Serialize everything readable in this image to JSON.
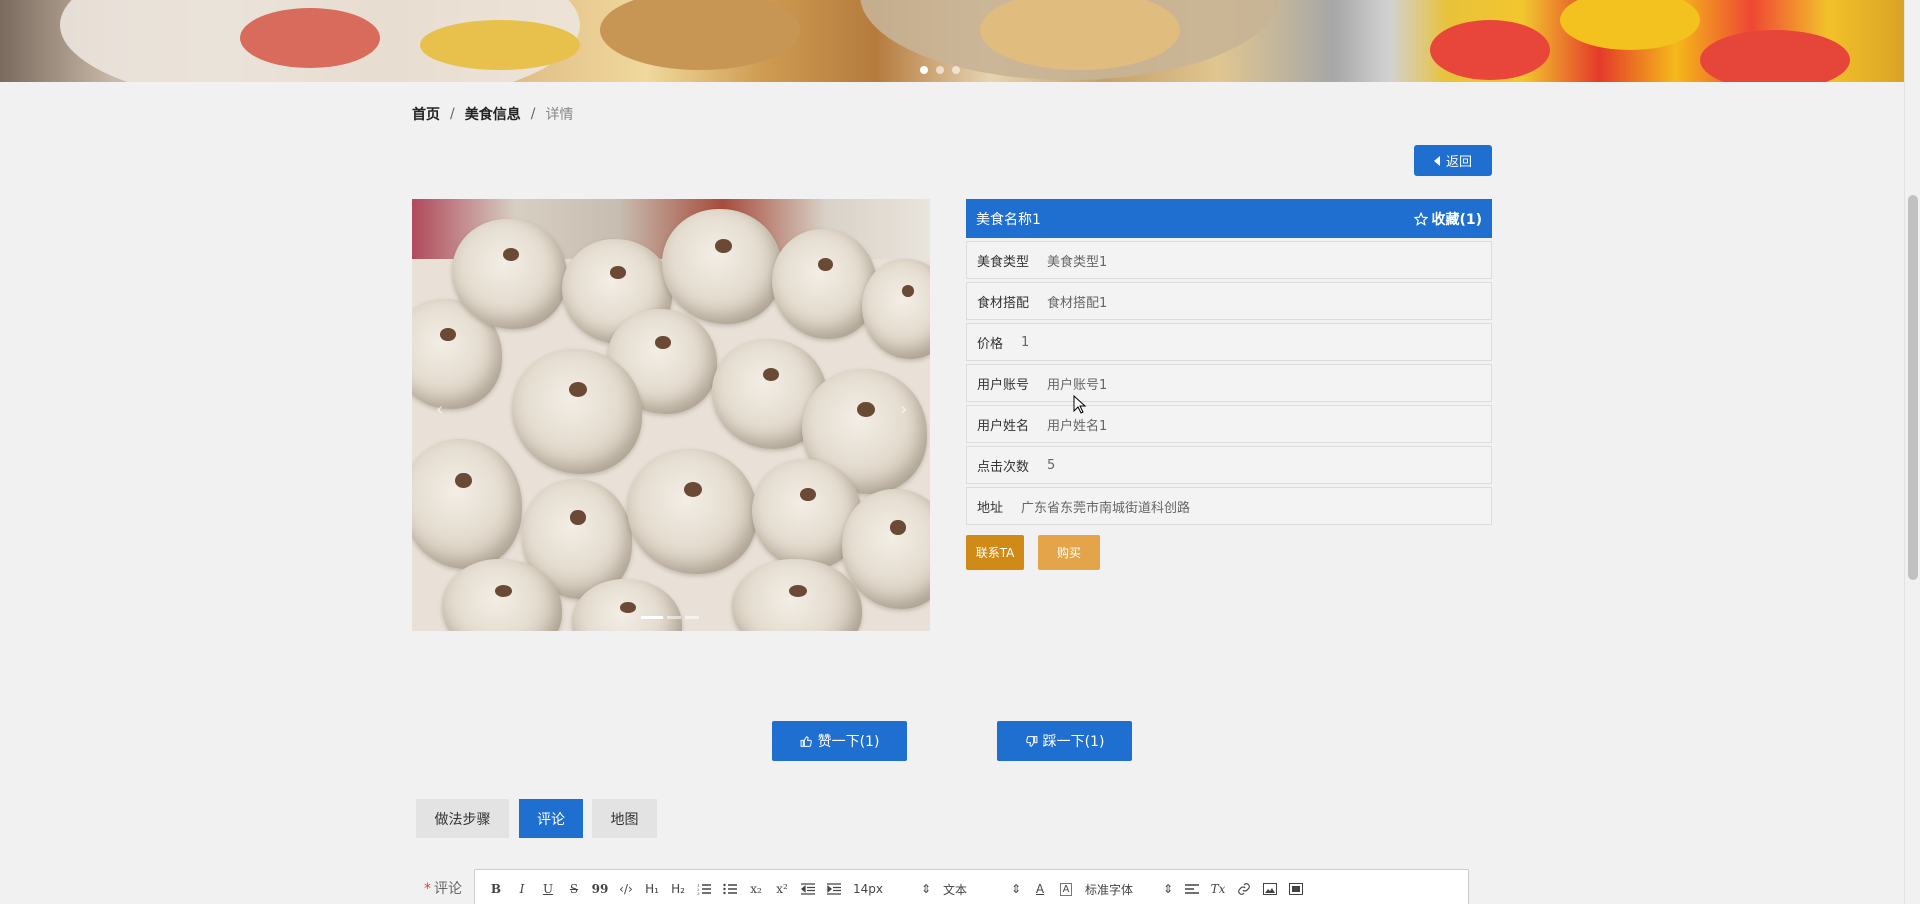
{
  "breadcrumb": {
    "home": "首页",
    "section": "美食信息",
    "current": "详情",
    "sep": "/"
  },
  "back_button": {
    "label": "返回",
    "icon": "caret-left-icon"
  },
  "food": {
    "name": "美食名称1",
    "favorite_label": "收藏(1)",
    "fields": [
      {
        "label": "美食类型",
        "value": "美食类型1"
      },
      {
        "label": "食材搭配",
        "value": "食材搭配1"
      },
      {
        "label": "价格",
        "value": "1"
      },
      {
        "label": "用户账号",
        "value": "用户账号1"
      },
      {
        "label": "用户姓名",
        "value": "用户姓名1"
      },
      {
        "label": "点击次数",
        "value": "5"
      },
      {
        "label": "地址",
        "value": "广东省东莞市南城街道科创路"
      }
    ]
  },
  "actions": {
    "contact": "联系TA",
    "buy": "购买"
  },
  "votes": {
    "like": "赞一下(1)",
    "dislike": "踩一下(1)"
  },
  "tabs": [
    {
      "label": "做法步骤",
      "active": false
    },
    {
      "label": "评论",
      "active": true
    },
    {
      "label": "地图",
      "active": false
    }
  ],
  "comment": {
    "required_mark": "*",
    "label": "评论",
    "toolbar": {
      "bold": "B",
      "italic": "I",
      "underline": "U",
      "strike": "S",
      "quote": "99",
      "code": "‹/›",
      "h1": "H₁",
      "h2": "H₂",
      "subscript": "x₂",
      "superscript": "x²",
      "size": "14px",
      "header": "文本",
      "font": "标准字体",
      "clear": "Tx"
    }
  },
  "colors": {
    "primary": "#1e6fd0",
    "contact": "#d08a18",
    "buy": "#e4a54a",
    "page_bg": "#f1f1f1"
  }
}
